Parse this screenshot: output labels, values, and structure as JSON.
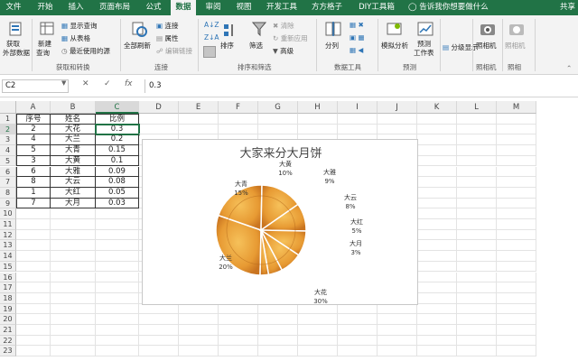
{
  "tabs": [
    "文件",
    "开始",
    "插入",
    "页面布局",
    "公式",
    "数据",
    "审阅",
    "视图",
    "开发工具",
    "方方格子",
    "DIY工具箱"
  ],
  "tellme": "告诉我你想要做什么",
  "share": "共享",
  "ribbon": {
    "get_external": [
      "获取",
      "外部数据"
    ],
    "new_query": [
      "新建",
      "查询"
    ],
    "show_query": "显示查询",
    "from_table": "从表格",
    "recent_sources": "最近使用的源",
    "refresh_all": "全部刷新",
    "connections": "连接",
    "properties": "属性",
    "edit_links": "编辑链接",
    "sort": "排序",
    "filter": "筛选",
    "clear": "清除",
    "reapply": "重新应用",
    "advanced": "高级",
    "text_to_columns": "分列",
    "what_if": "模拟分析",
    "forecast": [
      "预测",
      "工作表"
    ],
    "outline": "分级显示",
    "camera1": "照相机",
    "camera2": "照相机",
    "groups": {
      "get_transform": "获取和转换",
      "connections": "连接",
      "sort_filter": "排序和筛选",
      "data_tools": "数据工具",
      "forecast": "预测",
      "camera1": "照相机",
      "camera2": "照相"
    }
  },
  "formula_bar": {
    "name_box": "C2",
    "fx": "fx",
    "value": "0.3"
  },
  "columns": [
    "A",
    "B",
    "C",
    "D",
    "E",
    "F",
    "G",
    "H",
    "I",
    "J",
    "K",
    "L",
    "M"
  ],
  "rows": [
    "1",
    "2",
    "3",
    "4",
    "5",
    "6",
    "7",
    "8",
    "9",
    "10",
    "11",
    "12",
    "13",
    "14",
    "15",
    "16",
    "17",
    "18",
    "19",
    "20",
    "21",
    "22",
    "23"
  ],
  "table": {
    "headers": [
      "序号",
      "姓名",
      "比例"
    ],
    "rows": [
      [
        "2",
        "大花",
        "0.3"
      ],
      [
        "4",
        "大兰",
        "0.2"
      ],
      [
        "5",
        "大青",
        "0.15"
      ],
      [
        "3",
        "大黄",
        "0.1"
      ],
      [
        "6",
        "大雅",
        "0.09"
      ],
      [
        "8",
        "大云",
        "0.08"
      ],
      [
        "1",
        "大红",
        "0.05"
      ],
      [
        "7",
        "大月",
        "0.03"
      ]
    ]
  },
  "chart_data": {
    "type": "pie",
    "title": "大家来分大月饼",
    "categories": [
      "大花",
      "大兰",
      "大青",
      "大黄",
      "大雅",
      "大云",
      "大红",
      "大月"
    ],
    "values": [
      30,
      20,
      15,
      10,
      9,
      8,
      5,
      3
    ],
    "labels": [
      "30%",
      "20%",
      "15%",
      "10%",
      "9%",
      "8%",
      "5%",
      "3%"
    ]
  }
}
